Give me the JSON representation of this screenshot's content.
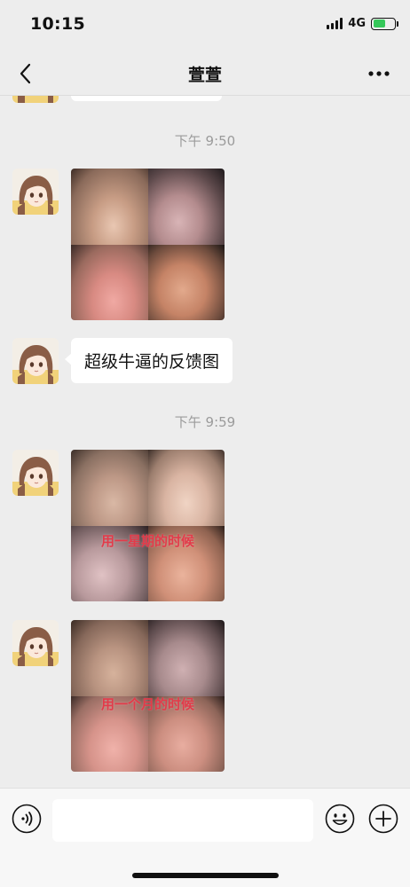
{
  "status_bar": {
    "time": "10:15",
    "network": "4G",
    "battery_level": 0.6,
    "battery_charging": true
  },
  "nav": {
    "title": "萱萱",
    "back_icon": "chevron-left-icon",
    "more_icon": "more-horizontal-icon"
  },
  "messages": [
    {
      "type": "timestamp",
      "text": "下午 9:50"
    },
    {
      "type": "image",
      "sender": "other",
      "caption": ""
    },
    {
      "type": "text",
      "sender": "other",
      "text": "超级牛逼的反馈图"
    },
    {
      "type": "timestamp",
      "text": "下午 9:59"
    },
    {
      "type": "image",
      "sender": "other",
      "caption": "用一星期的时候"
    },
    {
      "type": "image",
      "sender": "other",
      "caption": "用一个月的时候"
    }
  ],
  "input_bar": {
    "placeholder": "",
    "value": "",
    "voice_icon": "voice-icon",
    "emoji_icon": "emoji-icon",
    "plus_icon": "plus-circle-icon"
  },
  "colors": {
    "background": "#ededed",
    "bubble": "#ffffff",
    "timestamp": "#9b9b9b",
    "caption": "#e23b4a"
  }
}
